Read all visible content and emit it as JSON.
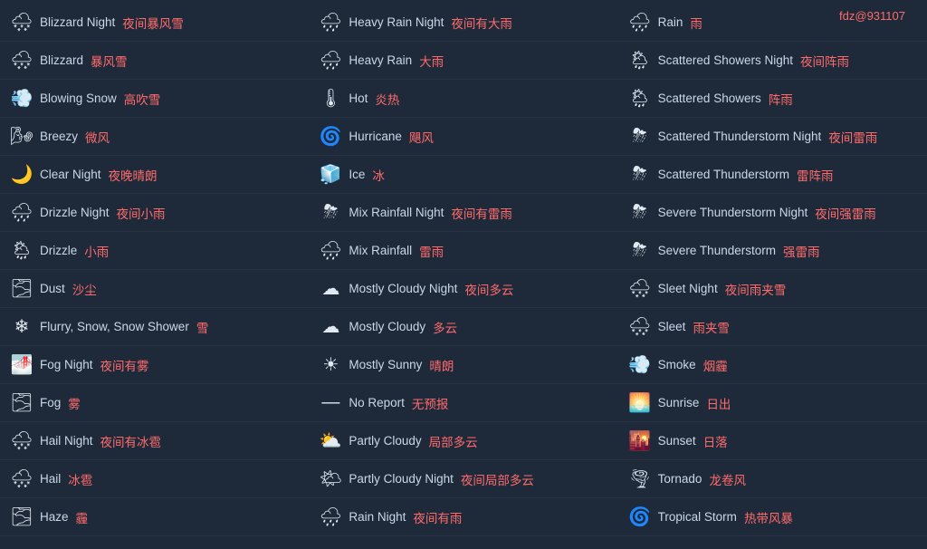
{
  "user_tag": "fdz@931107",
  "columns": [
    {
      "items": [
        {
          "icon": "❄️🌙",
          "en": "Blizzard Night",
          "zh": "夜间暴风雪"
        },
        {
          "icon": "❄️",
          "en": "Blizzard",
          "zh": "暴风雪"
        },
        {
          "icon": "💨❄️",
          "en": "Blowing Snow",
          "zh": "高吹雪"
        },
        {
          "icon": "💨",
          "en": "Breezy",
          "zh": "微风"
        },
        {
          "icon": "🌙",
          "en": "Clear Night",
          "zh": "夜晚晴朗"
        },
        {
          "icon": "🌧️🌙",
          "en": "Drizzle Night",
          "zh": "夜间小雨"
        },
        {
          "icon": "🌧️",
          "en": "Drizzle",
          "zh": "小雨"
        },
        {
          "icon": "☀️",
          "en": "Dust",
          "zh": "沙尘"
        },
        {
          "icon": "❄️",
          "en": "Flurry, Snow, Snow Shower",
          "zh": "雪"
        },
        {
          "icon": "🌫️🌙",
          "en": "Fog Night",
          "zh": "夜间有雾"
        },
        {
          "icon": "🌫️",
          "en": "Fog",
          "zh": "雾"
        },
        {
          "icon": "🌨️🌙",
          "en": "Hail Night",
          "zh": "夜间有冰雹"
        },
        {
          "icon": "🌨️",
          "en": "Hail",
          "zh": "冰雹"
        },
        {
          "icon": "🌁",
          "en": "Haze",
          "zh": "霾"
        }
      ]
    },
    {
      "items": [
        {
          "icon": "🌧️",
          "en": "Heavy Rain Night",
          "zh": "夜间有大雨"
        },
        {
          "icon": "🌧️",
          "en": "Heavy Rain",
          "zh": "大雨"
        },
        {
          "icon": "🌡️",
          "en": "Hot",
          "zh": "炎热"
        },
        {
          "icon": "🌀",
          "en": "Hurricane",
          "zh": "飓风"
        },
        {
          "icon": "🌡️",
          "en": "Ice",
          "zh": "冰"
        },
        {
          "icon": "🌧️",
          "en": "Mix Rainfall Night",
          "zh": "夜间有雷雨"
        },
        {
          "icon": "🌧️",
          "en": "Mix Rainfall",
          "zh": "雷雨"
        },
        {
          "icon": "☁️🌙",
          "en": "Mostly Cloudy Night",
          "zh": "夜间多云"
        },
        {
          "icon": "☁️",
          "en": "Mostly Cloudy",
          "zh": "多云"
        },
        {
          "icon": "☀️",
          "en": "Mostly Sunny",
          "zh": "晴朗"
        },
        {
          "icon": "---",
          "en": "No Report",
          "zh": "无预报"
        },
        {
          "icon": "⛅",
          "en": "Partly Cloudy",
          "zh": "局部多云"
        },
        {
          "icon": "🌙⛅",
          "en": "Partly Cloudy Night",
          "zh": "夜间局部多云"
        },
        {
          "icon": "🌧️🌙",
          "en": "Rain Night",
          "zh": "夜间有雨"
        }
      ]
    },
    {
      "items": [
        {
          "icon": "🌧️",
          "en": "Rain",
          "zh": "雨"
        },
        {
          "icon": "🌦️🌙",
          "en": "Scattered Showers Night",
          "zh": "夜间阵雨"
        },
        {
          "icon": "🌦️",
          "en": "Scattered Showers",
          "zh": "阵雨"
        },
        {
          "icon": "⛈️🌙",
          "en": "Scattered Thunderstorm Night",
          "zh": "夜间雷雨"
        },
        {
          "icon": "⛈️",
          "en": "Scattered Thunderstorm",
          "zh": "雷阵雨"
        },
        {
          "icon": "⛈️🌙",
          "en": "Severe Thunderstorm Night",
          "zh": "夜间强雷雨"
        },
        {
          "icon": "⛈️",
          "en": "Severe Thunderstorm",
          "zh": "强雷雨"
        },
        {
          "icon": "🌨️🌙",
          "en": "Sleet Night",
          "zh": "夜间雨夹雪"
        },
        {
          "icon": "🌨️",
          "en": "Sleet",
          "zh": "雨夹雪"
        },
        {
          "icon": "💨",
          "en": "Smoke",
          "zh": "烟霾"
        },
        {
          "icon": "🌅",
          "en": "Sunrise",
          "zh": "日出"
        },
        {
          "icon": "🌇",
          "en": "Sunset",
          "zh": "日落"
        },
        {
          "icon": "🌪️",
          "en": "Tornado",
          "zh": "龙卷风"
        },
        {
          "icon": "🌀",
          "en": "Tropical Storm",
          "zh": "热带风暴"
        }
      ]
    }
  ]
}
